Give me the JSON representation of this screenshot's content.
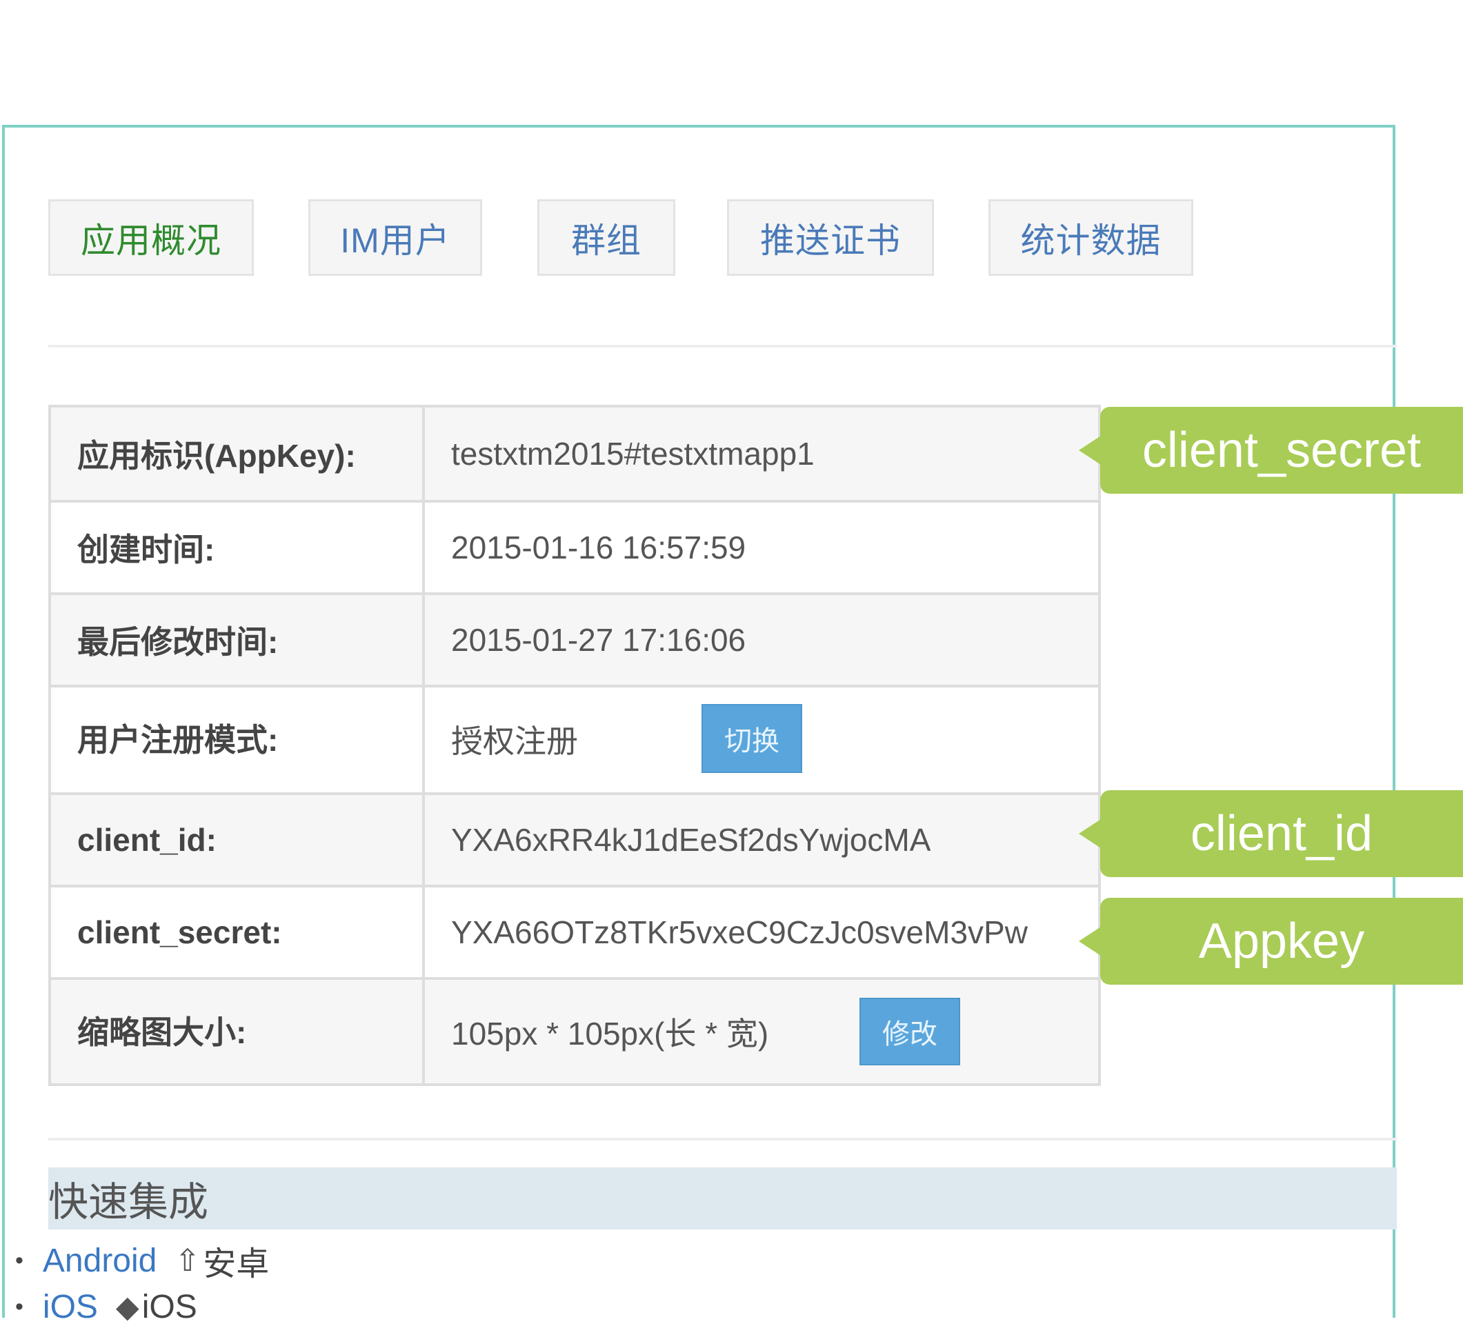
{
  "tabs": [
    {
      "label": "应用概况",
      "active": true
    },
    {
      "label": "IM用户",
      "active": false
    },
    {
      "label": "群组",
      "active": false
    },
    {
      "label": "推送证书",
      "active": false
    },
    {
      "label": "统计数据",
      "active": false
    }
  ],
  "info": {
    "appkey_label": "应用标识(AppKey):",
    "appkey_value": "testxtm2015#testxtmapp1",
    "created_label": "创建时间:",
    "created_value": "2015-01-16 16:57:59",
    "modified_label": "最后修改时间:",
    "modified_value": "2015-01-27 17:16:06",
    "reg_mode_label": "用户注册模式:",
    "reg_mode_value": "授权注册",
    "switch_button": "切换",
    "client_id_label": "client_id:",
    "client_id_value": "YXA6xRR4kJ1dEeSf2dsYwjocMA",
    "client_secret_label": "client_secret:",
    "client_secret_value": "YXA66OTz8TKr5vxeC9CzJc0sveM3vPw",
    "thumb_label": "缩略图大小:",
    "thumb_value": "105px  *  105px(长 * 宽)",
    "modify_button": "修改"
  },
  "callouts": {
    "first": "client_secret",
    "second": "client_id",
    "third": "Appkey"
  },
  "quick": {
    "title": "快速集成",
    "android_link": "Android",
    "android_icon": "android-icon",
    "android_text": "安卓",
    "ios_link": "iOS",
    "ios_icon": "apple-icon",
    "ios_text": "iOS"
  },
  "colors": {
    "panel_border": "#7fd0c5",
    "callout": "#a8cc55",
    "button": "#5aa6dc",
    "link": "#3a78c2",
    "active_tab": "#2e8b2e"
  }
}
